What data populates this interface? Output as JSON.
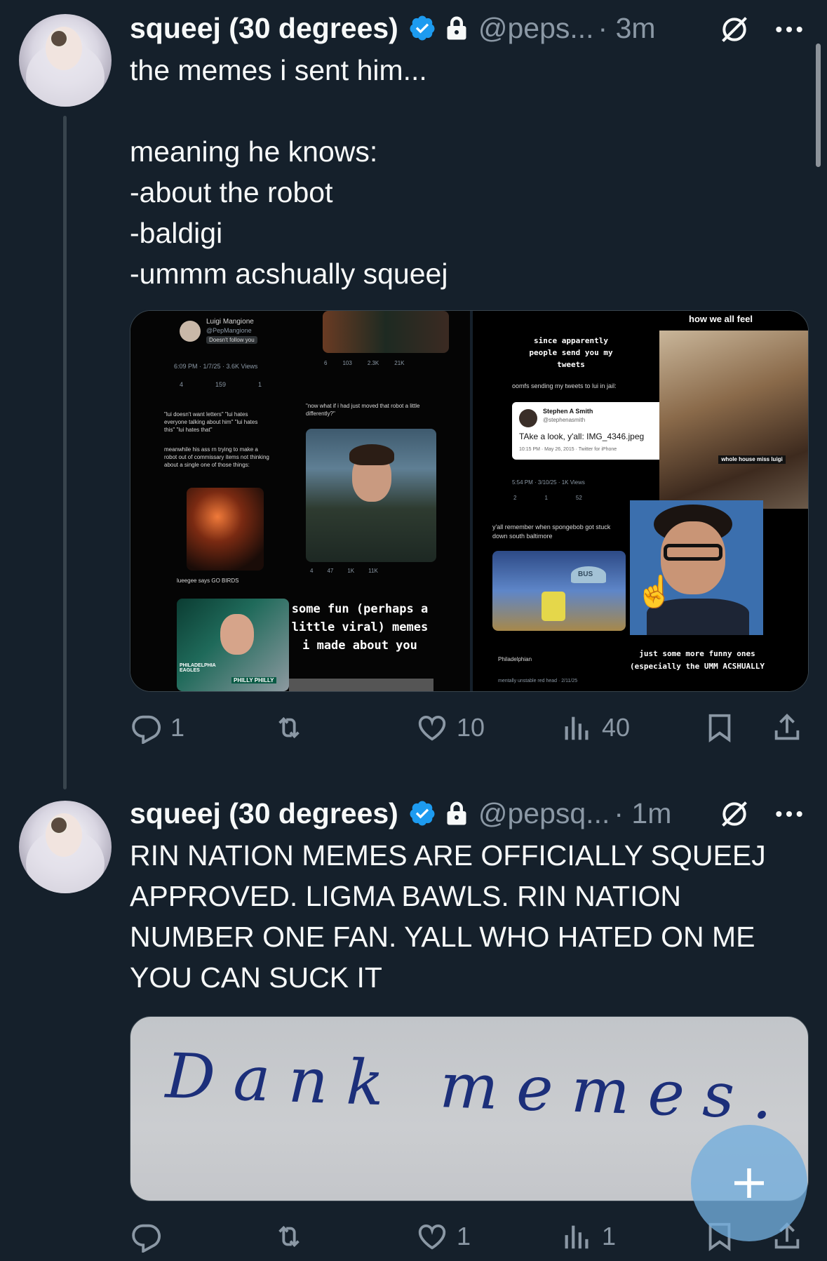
{
  "tweets": [
    {
      "name": "squeej (30 degrees)",
      "handle": "@peps...",
      "time": "· 3m",
      "text": "the memes i sent him...\n\nmeaning he knows:\n-about the robot\n-baldigi\n-ummm acshually squeej",
      "media": {
        "left_panel": {
          "profile_name": "Luigi Mangione",
          "profile_handle": "@PepMangione",
          "follow_badge": "Doesn't follow you",
          "timestamp": "6:09 PM · 1/7/25 · 3.6K Views",
          "stats": [
            "4",
            "159",
            "1"
          ],
          "quote_left": "\"lui doesn't want letters\" \"lui hates everyone talking about him\" \"lui hates this\" \"lui hates that\"",
          "quote_left_2": "meanwhile his ass rn trying to make a robot out of commissary items not thinking about a single one of those things:",
          "quote_right": "\"now what if i had just moved that robot a little differently?\"",
          "top_stats": [
            "6",
            "103",
            "2.3K",
            "21K"
          ],
          "mid_stats": [
            "4",
            "47",
            "1K",
            "11K"
          ],
          "bottom_handle": "lueegee says GO BIRDS",
          "caption": "some fun (perhaps a little viral) memes i made about you",
          "eagles_tag": "PHILLY PHILLY",
          "eagles_text": "PHILADELPHIA EAGLES"
        },
        "right_panel": {
          "top_caption": "how we all feel",
          "since": "since apparently people send you my tweets",
          "oomfs": "oomfs sending my tweets to lui in jail:",
          "card_name": "Stephen A Smith",
          "card_handle": "@stephenasmith",
          "card_text": "TAke a look, y'all: IMG_4346.jpeg",
          "card_meta": "10:15 PM · May 26, 2015 · Twitter for iPhone",
          "views": "5:54 PM · 3/10/25 · 1K Views",
          "views_stats": [
            "2",
            "1",
            "52"
          ],
          "house_tag": "whole house miss luigi",
          "spongebob": "y'all remember when spongebob got stuck down south baltimore",
          "sign": "BUS",
          "location": "Philadelphian",
          "bottom_caption": "just some more funny ones (especially the UMM ACSHUALLY",
          "footer": "mentally unstable red head · 2/11/25"
        }
      },
      "actions": {
        "reply": "1",
        "retweet": "",
        "like": "10",
        "views": "40"
      }
    },
    {
      "name": "squeej (30 degrees)",
      "handle": "@pepsq...",
      "time": "· 1m",
      "text": "RIN NATION MEMES ARE OFFICIALLY SQUEEJ APPROVED. LIGMA BAWLS. RIN NATION NUMBER ONE FAN. YALL WHO HATED ON ME YOU CAN SUCK IT",
      "media": {
        "handwriting": "Dank memes."
      },
      "actions": {
        "reply": "",
        "retweet": "",
        "like": "1",
        "views": "1"
      }
    }
  ],
  "colors": {
    "background": "#15202b",
    "text": "#f7f9f9",
    "secondary": "#8b98a5",
    "verified": "#1d9bf0",
    "fab": "#72addd"
  }
}
